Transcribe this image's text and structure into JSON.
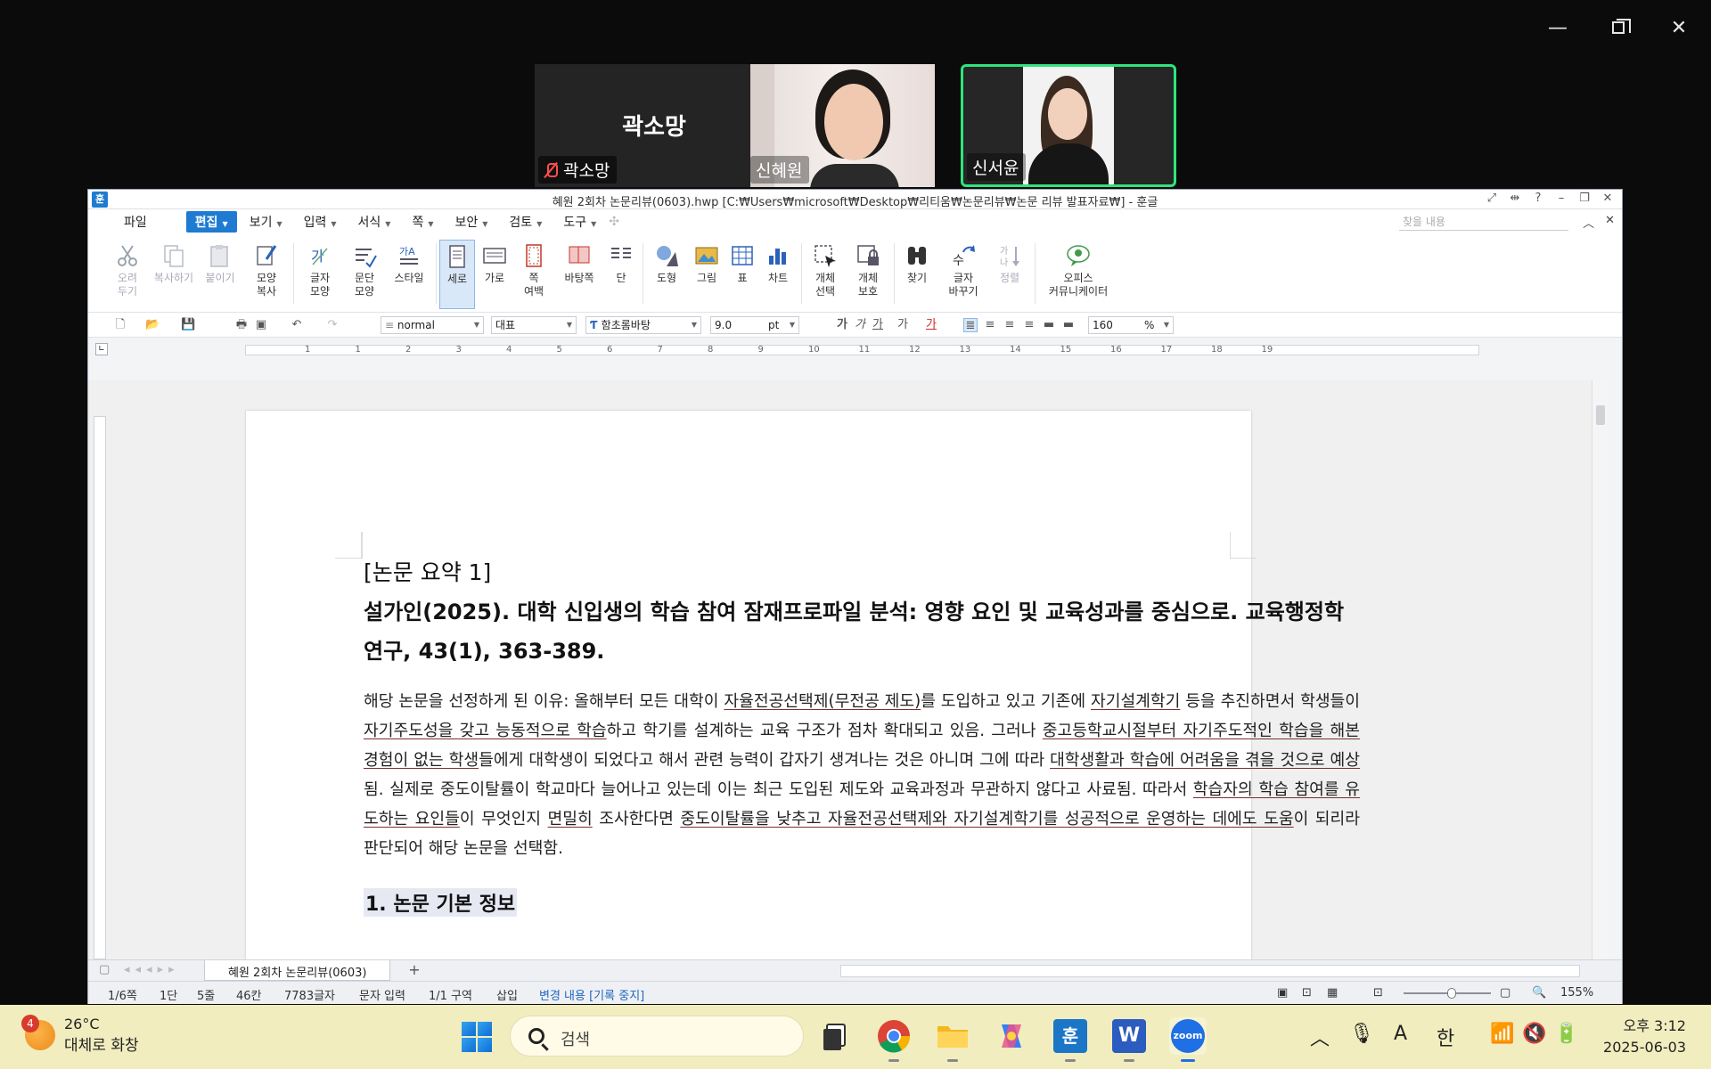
{
  "window_controls": {
    "minimize": "—",
    "close": "✕"
  },
  "participants": [
    {
      "name": "곽소망",
      "display_big": "곽소망",
      "muted": true
    },
    {
      "name": "신혜원"
    },
    {
      "name": "신서윤",
      "active_speaker_color": "#2ee57c"
    }
  ],
  "hwp": {
    "logo": "훈",
    "title": "혜원 2회차 논문리뷰(0603).hwp [C:₩Users₩microsoft₩Desktop₩리티움₩논문리뷰₩논문 리뷰 발표자료₩] - 훈글",
    "menus": [
      "파일",
      "편집",
      "보기",
      "입력",
      "서식",
      "쪽",
      "보안",
      "검토",
      "도구"
    ],
    "active_menu": "편집",
    "search_placeholder": "찾을 내용",
    "ribbon": [
      {
        "label": "오려\n두기",
        "icon": "scissors-icon"
      },
      {
        "label": "복사하기",
        "icon": "copy-icon"
      },
      {
        "label": "붙이기",
        "icon": "paste-icon"
      },
      {
        "label": "모양\n복사",
        "icon": "format-painter-icon"
      },
      {
        "label": "글자\n모양",
        "icon": "char-shape-icon"
      },
      {
        "label": "문단\n모양",
        "icon": "para-shape-icon"
      },
      {
        "label": "스타일",
        "icon": "style-icon"
      },
      {
        "label": "세로",
        "icon": "portrait-icon"
      },
      {
        "label": "가로",
        "icon": "landscape-icon"
      },
      {
        "label": "쪽\n여백",
        "icon": "margin-icon"
      },
      {
        "label": "바탕쪽",
        "icon": "master-page-icon"
      },
      {
        "label": "단",
        "icon": "columns-icon"
      },
      {
        "label": "도형",
        "icon": "shape-icon"
      },
      {
        "label": "그림",
        "icon": "picture-icon"
      },
      {
        "label": "표",
        "icon": "table-icon"
      },
      {
        "label": "차트",
        "icon": "chart-icon"
      },
      {
        "label": "개체\n선택",
        "icon": "select-object-icon"
      },
      {
        "label": "개체\n보호",
        "icon": "protect-object-icon"
      },
      {
        "label": "찾기",
        "icon": "binoculars-icon"
      },
      {
        "label": "글자\n바꾸기",
        "icon": "replace-char-icon"
      },
      {
        "label": "정렬",
        "icon": "sort-icon"
      },
      {
        "label": "오피스\n커뮤니케이터",
        "icon": "communicator-icon"
      }
    ],
    "format": {
      "style": "normal",
      "lang": "대표",
      "font": "함초롬바탕",
      "size": "9.0",
      "unit": "pt",
      "line_spacing": "160",
      "percent": "%",
      "char_buttons": [
        "가",
        "가",
        "가",
        "가",
        "가"
      ]
    },
    "ruler_numbers": [
      "1",
      "1",
      "2",
      "3",
      "4",
      "5",
      "6",
      "7",
      "8",
      "9",
      "10",
      "11",
      "12",
      "13",
      "14",
      "15",
      "16",
      "17",
      "18",
      "19"
    ],
    "document": {
      "label": "[논문 요약 1]",
      "citation": "설가인(2025). 대학 신입생의 학습 참여 잠재프로파일 분석: 영향 요인 및 교육성과를 중심으로. 교육행정학연구, 43(1), 363-389.",
      "para": [
        {
          "t": "해당 논문을 선정하게 된 이유: 올해부터 모든 대학이 ",
          "u": false
        },
        {
          "t": "자율전공선택제(무전공 제도)",
          "u": true
        },
        {
          "t": "를 도입하고 있고 기존에 ",
          "u": false
        },
        {
          "t": "자기설계학기",
          "u": true
        },
        {
          "t": " 등을 추진하면서 학생들이 ",
          "u": false
        },
        {
          "t": "자기주도성을 갖고 능동적으로 학습",
          "u": true
        },
        {
          "t": "하고 학기를 설계하는 교육 구조가 점차 확대되고 있음. 그러나 ",
          "u": false
        },
        {
          "t": "중고등학교시절부터 자기주도적인 학습을 해본 경험이 없는 학생",
          "u": true
        },
        {
          "t": "들에게 대학생이 되었다고 해서 관련 능력이 갑자기 생겨나는 것은 아니며 그에 따라 ",
          "u": false
        },
        {
          "t": "대학생활과 학습에 어려움을 겪을 것으로 예상",
          "u": true
        },
        {
          "t": "됨. 실제로 중도이탈률이 학교마다 늘어나고 있는데 이는 최근 도입된 제도와 교육과정과 무관하지 않다고 사료됨. 따라서 ",
          "u": false
        },
        {
          "t": "학습자의 학습 참여를 유도하는 요인들",
          "u": true
        },
        {
          "t": "이 무엇인지 ",
          "u": false
        },
        {
          "t": "면밀히",
          "u": true
        },
        {
          "t": " 조사한다면 ",
          "u": false
        },
        {
          "t": "중도이탈률을 낮추고 자율전공선택제와 자기설계학기를 성공적으로 운영하는 데에도 도움",
          "u": true
        },
        {
          "t": "이 되리라 판단되어 해당 논문을 선택함.",
          "u": false
        }
      ],
      "section_heading": "1. 논문 기본 정보"
    },
    "tab_name": "혜원 2회차 논문리뷰(0603)",
    "tab_add": "+",
    "status": {
      "page": "1/6쪽",
      "col": "1단",
      "line": "5줄",
      "char_col": "46칸",
      "chars": "7783글자",
      "input_mode": "문자 입력",
      "section": "1/1 구역",
      "insert": "삽입",
      "track": "변경 내용 [기록 중지]",
      "zoom": "155%",
      "zoom_level": 0.55
    }
  },
  "taskbar": {
    "weather_badge": "4",
    "temp": "26°C",
    "weather": "대체로 화창",
    "search": "검색",
    "apps": [
      "task-view-icon",
      "chrome-icon",
      "file-explorer-icon",
      "copilot-icon",
      "hangul-icon",
      "word-icon",
      "zoom-icon"
    ],
    "zoom_app_label": "zoom",
    "hwp_app_label": "훈",
    "word_app_label": "W",
    "ime_a": "A",
    "ime_han": "한",
    "time": "오후 3:12",
    "date": "2025-06-03"
  }
}
